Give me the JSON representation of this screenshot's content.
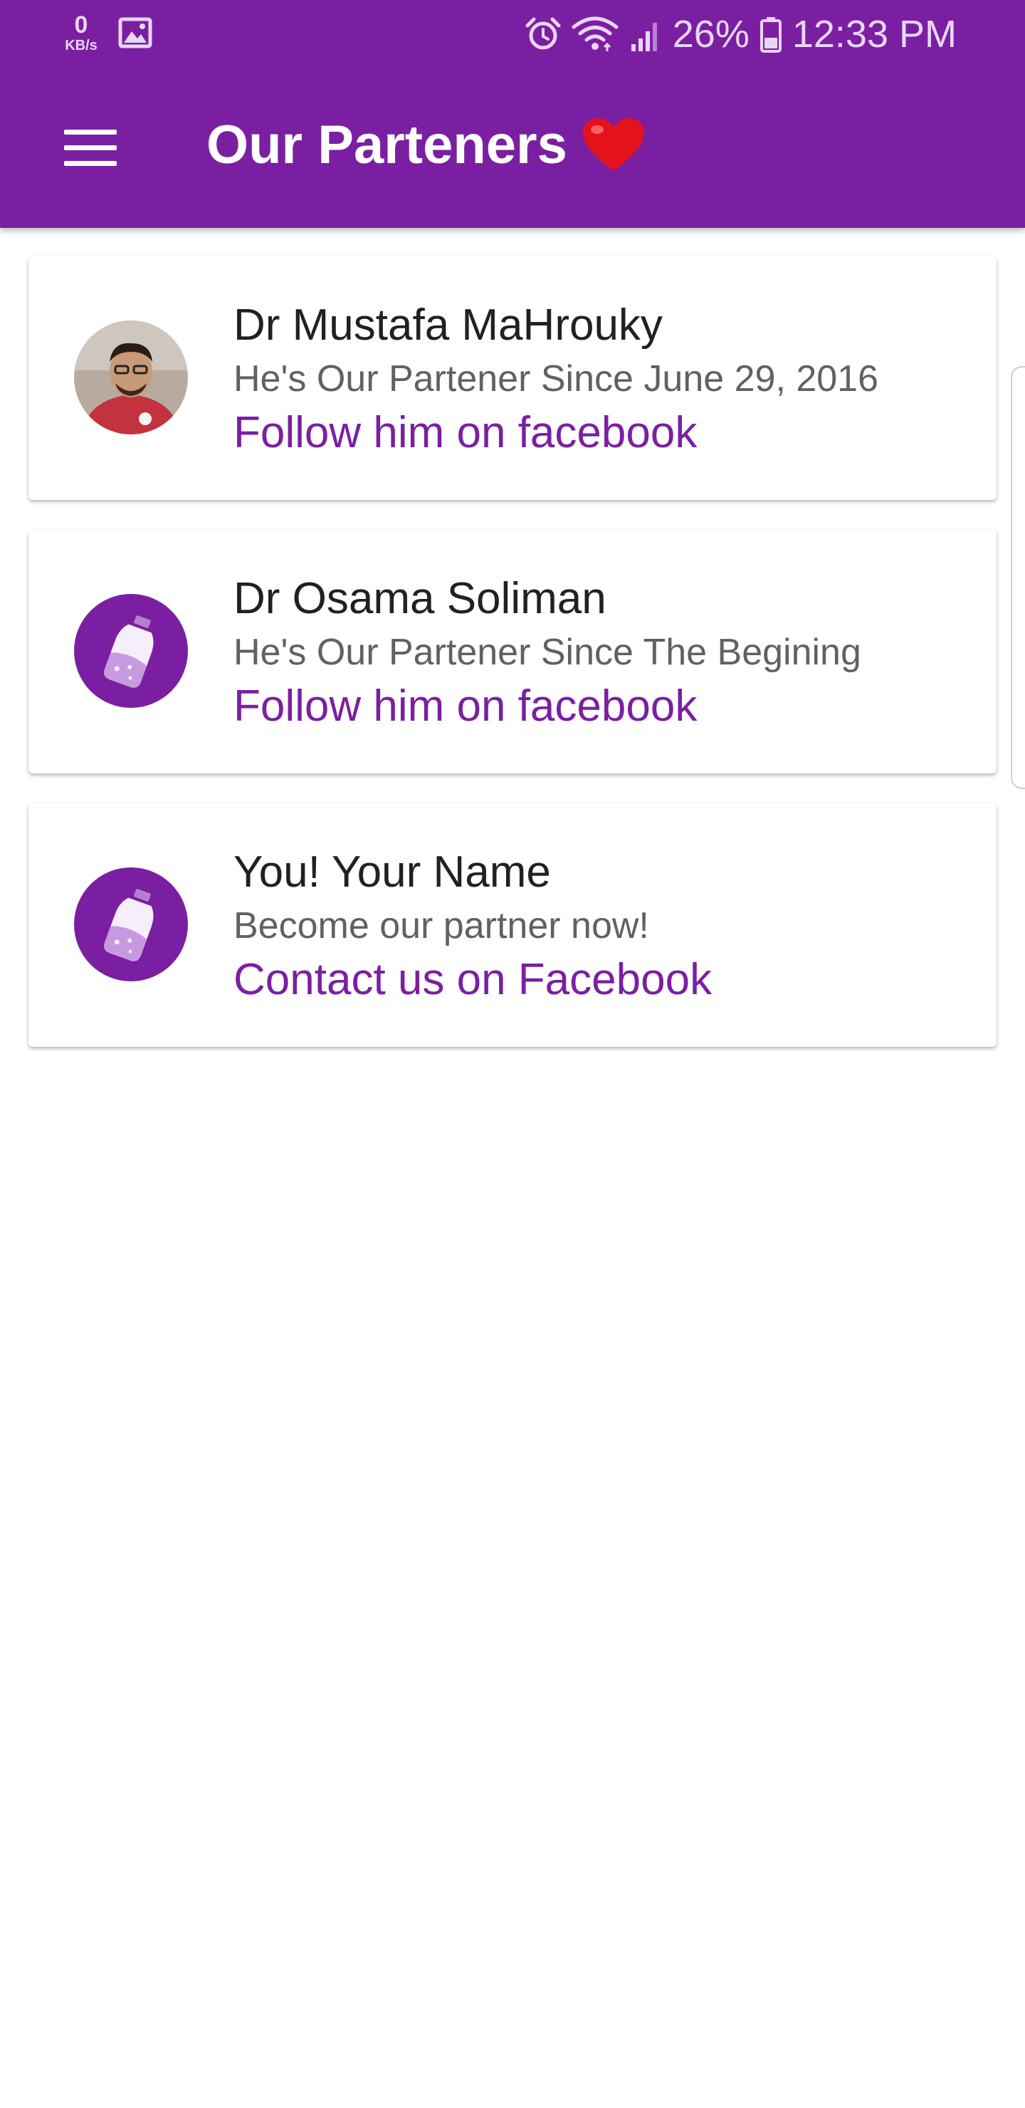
{
  "status_bar": {
    "net_speed_value": "0",
    "net_speed_unit": "KB/s",
    "battery_percent": "26%",
    "time": "12:33 PM",
    "icons": [
      "image-icon",
      "alarm-icon",
      "wifi-icon",
      "signal-icon",
      "battery-icon"
    ]
  },
  "app_bar": {
    "title": "Our Parteners",
    "title_emoji_icon": "heart-icon",
    "menu_icon": "menu-icon"
  },
  "partners": [
    {
      "name": "Dr Mustafa MaHrouky",
      "since": "He's Our Partener Since June 29, 2016",
      "link": "Follow him on facebook",
      "avatar": "photo-avatar"
    },
    {
      "name": "Dr Osama Soliman",
      "since": "He's Our Partener Since The Begining",
      "link": "Follow him on facebook",
      "avatar": "bottle-icon"
    },
    {
      "name": "You! Your Name",
      "since": "Become our partner now!",
      "link": "Contact us on Facebook",
      "avatar": "bottle-icon"
    }
  ],
  "colors": {
    "primary": "#7b1fa2",
    "text_primary": "#212121",
    "text_secondary": "#616161",
    "background": "#ffffff"
  }
}
